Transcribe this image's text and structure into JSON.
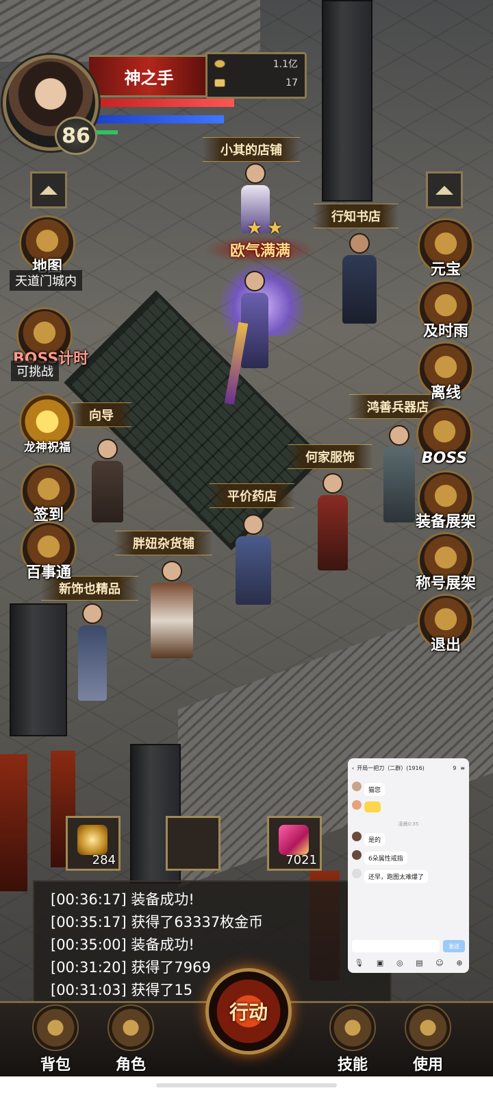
{
  "player": {
    "name": "神之手",
    "level": "86",
    "gold": "1.1亿",
    "ingots": "17"
  },
  "left_menu": {
    "map_label": "地图",
    "map_location": "天道门城内",
    "boss_timer_label": "BOSS计时",
    "boss_timer_status": "可挑战",
    "dragon_blessing_label": "龙神祝福",
    "sign_in_label": "签到",
    "encyclopedia_label": "百事通"
  },
  "right_menu": {
    "yuanbao_label": "元宝",
    "jishiyu_label": "及时雨",
    "offline_label": "离线",
    "boss_label": "BOSS",
    "equipment_rack_label": "装备展架",
    "title_rack_label": "称号展架",
    "exit_label": "退出"
  },
  "npc_tags": {
    "xiaoqi_shop": "小其的店铺",
    "xingzhi_bookstore": "行知书店",
    "guide": "向导",
    "hongshan_weapons": "鸿善兵器店",
    "hejia_clothing": "何家服饰",
    "pingjia_pharmacy": "平价药店",
    "pangniu_general": "胖妞杂货铺",
    "xinshi_jewelry": "新饰也精品"
  },
  "hero_title": "欧气满满",
  "quick_slots": [
    {
      "count": "284"
    },
    {
      "count": ""
    },
    {
      "count": "7021"
    }
  ],
  "log_lines": [
    "[00:36:17] 装备成功!",
    "[00:35:17] 获得了63337枚金币",
    "[00:35:00] 装备成功!",
    "[00:31:20] 获得了7969",
    "[00:31:03] 获得了15"
  ],
  "bottom_menu": {
    "bag": "背包",
    "character": "角色",
    "action": "行动",
    "skills": "技能",
    "use": "使用"
  },
  "chat_overlay": {
    "title": "开局一把刀（二群）(1916)",
    "count": "9",
    "messages": [
      {
        "name": "",
        "text": "猫您"
      },
      {
        "name": "",
        "text": ""
      },
      {
        "name": "",
        "text": "是的"
      },
      {
        "name": "",
        "text": "6朵属性戒指"
      },
      {
        "name": "",
        "text": "还早，跑图太难爆了"
      }
    ],
    "time": "凌晨0:35",
    "send_label": "发送"
  }
}
